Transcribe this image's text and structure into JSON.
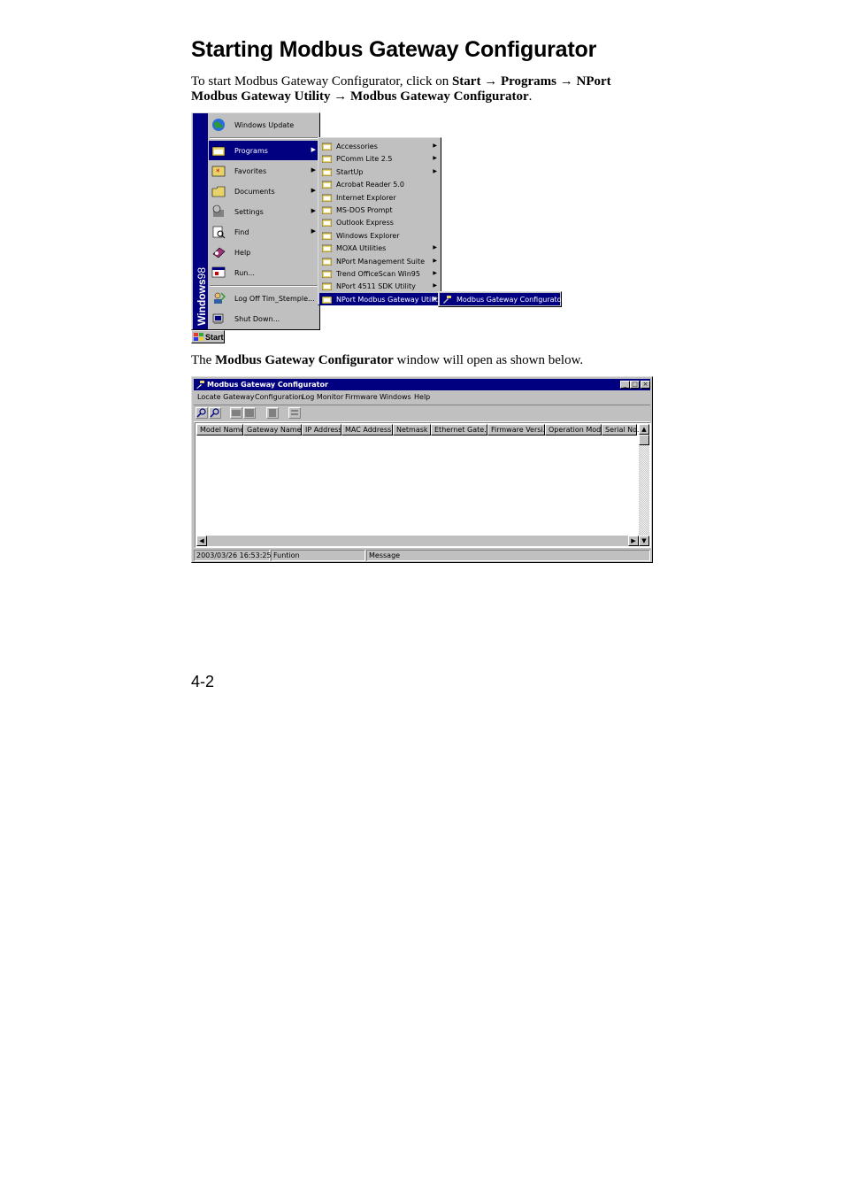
{
  "heading": "Starting Modbus Gateway Configurator",
  "intro": {
    "t1": "To start Modbus Gateway Configurator, click on ",
    "b1": "Start",
    "arrow": " → ",
    "b2": "Programs",
    "b3": "NPort Modbus Gateway Utility",
    "b4": "Modbus Gateway Configurator",
    "end": "."
  },
  "start_menu": {
    "brand_bold": "Windows",
    "brand_num": "98",
    "items": [
      {
        "label": "Windows Update"
      },
      {
        "label": "Programs"
      },
      {
        "label": "Favorites"
      },
      {
        "label": "Documents"
      },
      {
        "label": "Settings"
      },
      {
        "label": "Find"
      },
      {
        "label": "Help"
      },
      {
        "label": "Run..."
      },
      {
        "label": "Log Off Tim_Stemple..."
      },
      {
        "label": "Shut Down..."
      }
    ],
    "start_button": "Start"
  },
  "programs_menu": [
    "Accessories",
    "PComm Lite 2.5",
    "StartUp",
    "Acrobat Reader 5.0",
    "Internet Explorer",
    "MS-DOS Prompt",
    "Outlook Express",
    "Windows Explorer",
    "MOXA Utilities",
    "NPort Management Suite",
    "Trend OfficeScan Win95",
    "NPort 4511 SDK Utility",
    "NPort Modbus Gateway Utility"
  ],
  "utility_menu": [
    "Modbus Gateway Configurator"
  ],
  "caption": {
    "t1": "The ",
    "b1": "Modbus Gateway Configurator",
    "t2": " window will open as shown below."
  },
  "window": {
    "title": "Modbus Gateway Configurator",
    "menu": [
      "Locate Gateway",
      "Configuration",
      "Log Monitor",
      "Firmware",
      "Windows",
      "Help"
    ],
    "columns": [
      "Model Name",
      "Gateway Name",
      "IP Address",
      "MAC Address",
      "Netmask",
      "Ethernet Gate...",
      "Firmware Versi...",
      "Operation Mode",
      "Serial No."
    ],
    "status": [
      "2003/03/26 16:53:25",
      "Funtion",
      "Message"
    ]
  },
  "page_number": "4-2"
}
